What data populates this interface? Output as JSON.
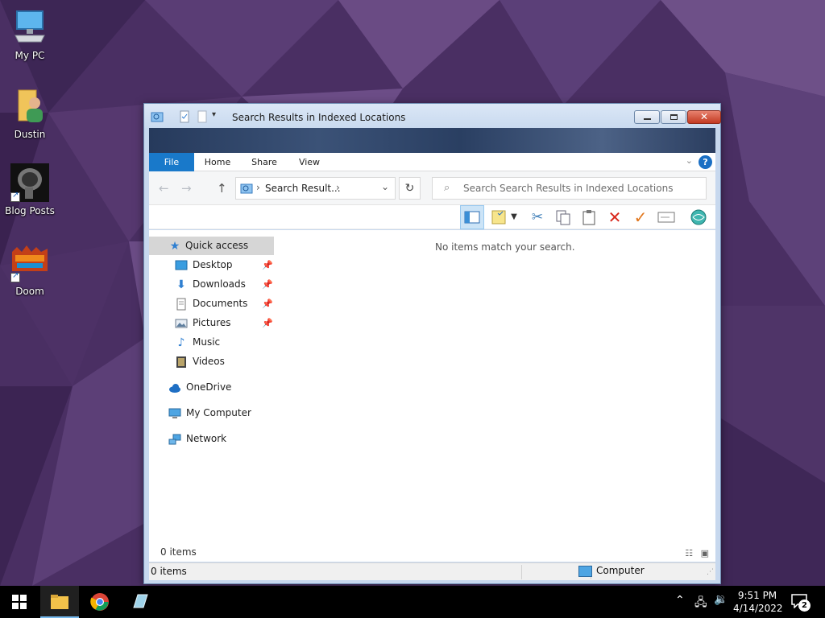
{
  "desktop": {
    "icons": [
      {
        "label": "My PC",
        "icon": "monitor-icon"
      },
      {
        "label": "Dustin",
        "icon": "user-folder-icon"
      },
      {
        "label": "Blog Posts",
        "icon": "blog-posts-shortcut-icon"
      },
      {
        "label": "Doom",
        "icon": "doom-shortcut-icon"
      }
    ]
  },
  "window": {
    "title": "Search Results in Indexed Locations",
    "ribbon_tabs": [
      "File",
      "Home",
      "Share",
      "View"
    ],
    "help_label": "?",
    "address": {
      "text": "Search Result...",
      "separator": "›"
    },
    "search": {
      "placeholder": "Search Search Results in Indexed Locations"
    },
    "empty_message": "No items match your search.",
    "nav_pane": {
      "quick_access": "Quick access",
      "pinned": [
        {
          "label": "Desktop",
          "pinned": true
        },
        {
          "label": "Downloads",
          "pinned": true
        },
        {
          "label": "Documents",
          "pinned": true
        },
        {
          "label": "Pictures",
          "pinned": true
        },
        {
          "label": "Music",
          "pinned": false
        },
        {
          "label": "Videos",
          "pinned": false
        }
      ],
      "onedrive": "OneDrive",
      "my_computer": "My Computer",
      "network": "Network"
    },
    "status_items": "0 items",
    "status_bar": {
      "items": "0 items",
      "zone": "Computer"
    }
  },
  "taskbar": {
    "clock_time": "9:51 PM",
    "clock_date": "4/14/2022",
    "notification_count": "2"
  },
  "colors": {
    "accent": "#1979ca",
    "wallpaper_base": "#4a2f63",
    "delete_red": "#d9281c",
    "check_orange": "#e1761c"
  }
}
